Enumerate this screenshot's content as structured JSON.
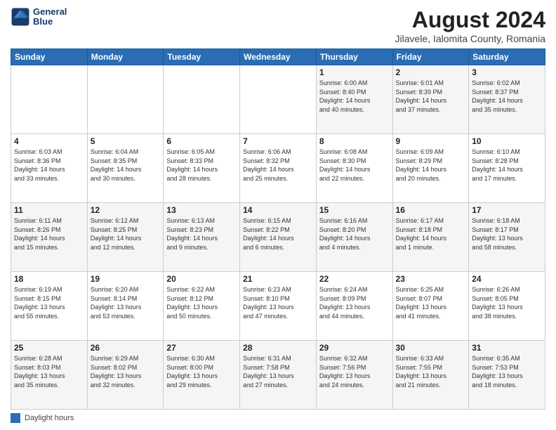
{
  "header": {
    "logo_line1": "General",
    "logo_line2": "Blue",
    "title": "August 2024",
    "subtitle": "Jilavele, Ialomita County, Romania"
  },
  "days_of_week": [
    "Sunday",
    "Monday",
    "Tuesday",
    "Wednesday",
    "Thursday",
    "Friday",
    "Saturday"
  ],
  "legend_label": "Daylight hours",
  "weeks": [
    [
      {
        "day": "",
        "info": ""
      },
      {
        "day": "",
        "info": ""
      },
      {
        "day": "",
        "info": ""
      },
      {
        "day": "",
        "info": ""
      },
      {
        "day": "1",
        "info": "Sunrise: 6:00 AM\nSunset: 8:40 PM\nDaylight: 14 hours\nand 40 minutes."
      },
      {
        "day": "2",
        "info": "Sunrise: 6:01 AM\nSunset: 8:39 PM\nDaylight: 14 hours\nand 37 minutes."
      },
      {
        "day": "3",
        "info": "Sunrise: 6:02 AM\nSunset: 8:37 PM\nDaylight: 14 hours\nand 35 minutes."
      }
    ],
    [
      {
        "day": "4",
        "info": "Sunrise: 6:03 AM\nSunset: 8:36 PM\nDaylight: 14 hours\nand 33 minutes."
      },
      {
        "day": "5",
        "info": "Sunrise: 6:04 AM\nSunset: 8:35 PM\nDaylight: 14 hours\nand 30 minutes."
      },
      {
        "day": "6",
        "info": "Sunrise: 6:05 AM\nSunset: 8:33 PM\nDaylight: 14 hours\nand 28 minutes."
      },
      {
        "day": "7",
        "info": "Sunrise: 6:06 AM\nSunset: 8:32 PM\nDaylight: 14 hours\nand 25 minutes."
      },
      {
        "day": "8",
        "info": "Sunrise: 6:08 AM\nSunset: 8:30 PM\nDaylight: 14 hours\nand 22 minutes."
      },
      {
        "day": "9",
        "info": "Sunrise: 6:09 AM\nSunset: 8:29 PM\nDaylight: 14 hours\nand 20 minutes."
      },
      {
        "day": "10",
        "info": "Sunrise: 6:10 AM\nSunset: 8:28 PM\nDaylight: 14 hours\nand 17 minutes."
      }
    ],
    [
      {
        "day": "11",
        "info": "Sunrise: 6:11 AM\nSunset: 8:26 PM\nDaylight: 14 hours\nand 15 minutes."
      },
      {
        "day": "12",
        "info": "Sunrise: 6:12 AM\nSunset: 8:25 PM\nDaylight: 14 hours\nand 12 minutes."
      },
      {
        "day": "13",
        "info": "Sunrise: 6:13 AM\nSunset: 8:23 PM\nDaylight: 14 hours\nand 9 minutes."
      },
      {
        "day": "14",
        "info": "Sunrise: 6:15 AM\nSunset: 8:22 PM\nDaylight: 14 hours\nand 6 minutes."
      },
      {
        "day": "15",
        "info": "Sunrise: 6:16 AM\nSunset: 8:20 PM\nDaylight: 14 hours\nand 4 minutes."
      },
      {
        "day": "16",
        "info": "Sunrise: 6:17 AM\nSunset: 8:18 PM\nDaylight: 14 hours\nand 1 minute."
      },
      {
        "day": "17",
        "info": "Sunrise: 6:18 AM\nSunset: 8:17 PM\nDaylight: 13 hours\nand 58 minutes."
      }
    ],
    [
      {
        "day": "18",
        "info": "Sunrise: 6:19 AM\nSunset: 8:15 PM\nDaylight: 13 hours\nand 55 minutes."
      },
      {
        "day": "19",
        "info": "Sunrise: 6:20 AM\nSunset: 8:14 PM\nDaylight: 13 hours\nand 53 minutes."
      },
      {
        "day": "20",
        "info": "Sunrise: 6:22 AM\nSunset: 8:12 PM\nDaylight: 13 hours\nand 50 minutes."
      },
      {
        "day": "21",
        "info": "Sunrise: 6:23 AM\nSunset: 8:10 PM\nDaylight: 13 hours\nand 47 minutes."
      },
      {
        "day": "22",
        "info": "Sunrise: 6:24 AM\nSunset: 8:09 PM\nDaylight: 13 hours\nand 44 minutes."
      },
      {
        "day": "23",
        "info": "Sunrise: 6:25 AM\nSunset: 8:07 PM\nDaylight: 13 hours\nand 41 minutes."
      },
      {
        "day": "24",
        "info": "Sunrise: 6:26 AM\nSunset: 8:05 PM\nDaylight: 13 hours\nand 38 minutes."
      }
    ],
    [
      {
        "day": "25",
        "info": "Sunrise: 6:28 AM\nSunset: 8:03 PM\nDaylight: 13 hours\nand 35 minutes."
      },
      {
        "day": "26",
        "info": "Sunrise: 6:29 AM\nSunset: 8:02 PM\nDaylight: 13 hours\nand 32 minutes."
      },
      {
        "day": "27",
        "info": "Sunrise: 6:30 AM\nSunset: 8:00 PM\nDaylight: 13 hours\nand 29 minutes."
      },
      {
        "day": "28",
        "info": "Sunrise: 6:31 AM\nSunset: 7:58 PM\nDaylight: 13 hours\nand 27 minutes."
      },
      {
        "day": "29",
        "info": "Sunrise: 6:32 AM\nSunset: 7:56 PM\nDaylight: 13 hours\nand 24 minutes."
      },
      {
        "day": "30",
        "info": "Sunrise: 6:33 AM\nSunset: 7:55 PM\nDaylight: 13 hours\nand 21 minutes."
      },
      {
        "day": "31",
        "info": "Sunrise: 6:35 AM\nSunset: 7:53 PM\nDaylight: 13 hours\nand 18 minutes."
      }
    ]
  ]
}
